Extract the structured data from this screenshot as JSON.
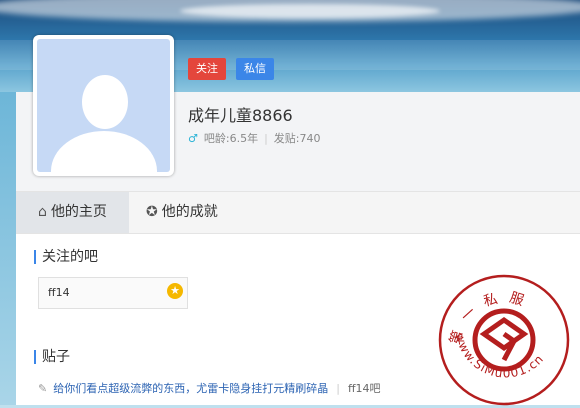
{
  "profile": {
    "username": "成年儿童8866",
    "age_label": "吧龄:6.5年",
    "posts_label": "发贴:740",
    "follow_button": "关注",
    "message_button": "私信",
    "gender_icon": "male-icon"
  },
  "tabs": [
    {
      "label": "他的主页",
      "icon": "home-icon",
      "active": true
    },
    {
      "label": "他的成就",
      "icon": "award-icon",
      "active": false
    }
  ],
  "followed": {
    "title": "关注的吧",
    "bars": [
      {
        "name": "ff14",
        "badge_icon": "star-icon"
      }
    ]
  },
  "posts": {
    "title": "贴子",
    "items": [
      {
        "title": "给你们看点超级流弊的东西，尤雷卡隐身挂打元精刷碎晶",
        "forum": "ff14吧"
      }
    ]
  },
  "watermark": {
    "text_top": "第一私服",
    "url": "www.SiMu001.cn"
  },
  "colors": {
    "follow": "#e4463c",
    "message": "#3b86e8",
    "link": "#2d64b3",
    "stamp": "#b41e1e"
  }
}
